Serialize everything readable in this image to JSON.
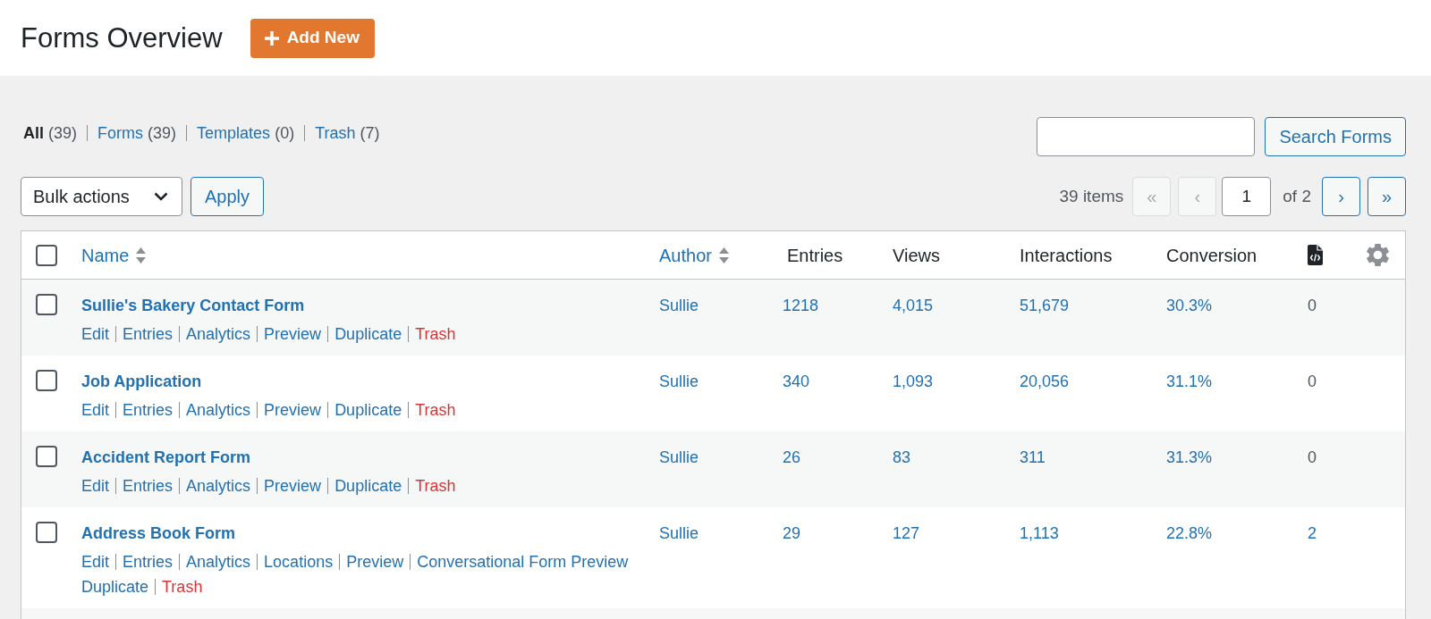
{
  "header": {
    "title": "Forms Overview",
    "add_button": "Add New"
  },
  "views": [
    {
      "label": "All",
      "count": "(39)",
      "selected": true
    },
    {
      "label": "Forms",
      "count": "(39)",
      "selected": false
    },
    {
      "label": "Templates",
      "count": "(0)",
      "selected": false
    },
    {
      "label": "Trash",
      "count": "(7)",
      "selected": false
    }
  ],
  "search": {
    "button": "Search Forms"
  },
  "bulk_actions": {
    "value": "Bulk actions",
    "apply_button": "Apply"
  },
  "pagination": {
    "count": "39 items",
    "buttons_before": [
      {
        "label": "«",
        "disabled": true
      },
      {
        "label": "‹",
        "disabled": true
      }
    ],
    "current_page": "1",
    "total": "of 2",
    "buttons_after": [
      {
        "label": "›",
        "disabled": false
      },
      {
        "label": "»",
        "disabled": false
      }
    ]
  },
  "table": {
    "select_all": {
      "checked": false
    },
    "columns": [
      {
        "kind": "label",
        "label": "Name",
        "sortable": true
      },
      {
        "kind": "label",
        "label": "Author",
        "sortable": true
      },
      {
        "kind": "label",
        "label": "Entries",
        "sortable": false
      },
      {
        "kind": "label",
        "label": "Views",
        "sortable": false
      },
      {
        "kind": "label",
        "label": "Interactions",
        "sortable": false
      },
      {
        "kind": "label",
        "label": "Conversion",
        "sortable": false
      },
      {
        "kind": "code"
      },
      {
        "kind": "settings"
      }
    ],
    "rows": [
      {
        "checked": false,
        "name": "Sullie's Bakery Contact Form",
        "actions": [
          {
            "label": "Edit",
            "kind": "link"
          },
          {
            "label": "Entries",
            "kind": "link"
          },
          {
            "label": "Analytics",
            "kind": "link"
          },
          {
            "label": "Preview",
            "kind": "link"
          },
          {
            "label": "Duplicate",
            "kind": "link"
          },
          {
            "label": "Trash",
            "kind": "danger"
          }
        ],
        "author": "Sullie",
        "entries": "1218",
        "views": "4,015",
        "interactions": "51,679",
        "conversion": "30.3%",
        "column_7": {
          "text": "0",
          "linked": false
        }
      },
      {
        "checked": false,
        "name": "Job Application",
        "actions": [
          {
            "label": "Edit",
            "kind": "link"
          },
          {
            "label": "Entries",
            "kind": "link"
          },
          {
            "label": "Analytics",
            "kind": "link"
          },
          {
            "label": "Preview",
            "kind": "link"
          },
          {
            "label": "Duplicate",
            "kind": "link"
          },
          {
            "label": "Trash",
            "kind": "danger"
          }
        ],
        "author": "Sullie",
        "entries": "340",
        "views": "1,093",
        "interactions": "20,056",
        "conversion": "31.1%",
        "column_7": {
          "text": "0",
          "linked": false
        }
      },
      {
        "checked": false,
        "name": "Accident Report Form",
        "actions": [
          {
            "label": "Edit",
            "kind": "link"
          },
          {
            "label": "Entries",
            "kind": "link"
          },
          {
            "label": "Analytics",
            "kind": "link"
          },
          {
            "label": "Preview",
            "kind": "link"
          },
          {
            "label": "Duplicate",
            "kind": "link"
          },
          {
            "label": "Trash",
            "kind": "danger"
          }
        ],
        "author": "Sullie",
        "entries": "26",
        "views": "83",
        "interactions": "311",
        "conversion": "31.3%",
        "column_7": {
          "text": "0",
          "linked": false
        }
      },
      {
        "checked": false,
        "name": "Address Book Form",
        "actions": [
          {
            "label": "Edit",
            "kind": "link"
          },
          {
            "label": "Entries",
            "kind": "link"
          },
          {
            "label": "Analytics",
            "kind": "link"
          },
          {
            "label": "Locations",
            "kind": "link"
          },
          {
            "label": "Preview",
            "kind": "link"
          },
          {
            "label": "Conversational Form Preview",
            "kind": "link"
          },
          {
            "label": "Duplicate",
            "kind": "link"
          },
          {
            "label": "Trash",
            "kind": "danger"
          }
        ],
        "author": "Sullie",
        "entries": "29",
        "views": "127",
        "interactions": "1,113",
        "conversion": "22.8%",
        "column_7": {
          "text": "2",
          "linked": true
        }
      }
    ]
  }
}
